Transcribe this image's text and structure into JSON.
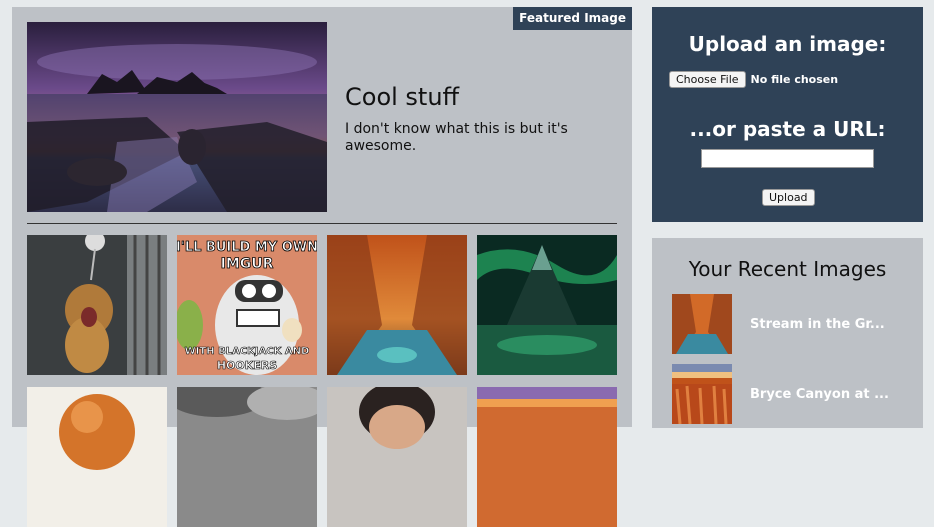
{
  "featured": {
    "badge": "Featured Image",
    "title": "Cool stuff",
    "description": "I don't know what this is but it's awesome."
  },
  "thumbnails": [
    {
      "name": "lion-cub-image"
    },
    {
      "name": "bender-meme-image",
      "top_text": "I'LL BUILD MY OWN IMGUR",
      "bottom_text": "WITH BLACKJACK AND HOOKERS"
    },
    {
      "name": "canyon-stream-image"
    },
    {
      "name": "aurora-mountain-image"
    },
    {
      "name": "furry-animal-image"
    },
    {
      "name": "storm-clouds-image"
    },
    {
      "name": "portrait-image"
    },
    {
      "name": "sunset-landscape-image"
    }
  ],
  "upload": {
    "title": "Upload an image:",
    "choose_file_label": "Choose File",
    "file_status": "No file chosen",
    "paste_url_title": "...or paste a URL:",
    "url_value": "",
    "upload_button": "Upload"
  },
  "recent": {
    "title": "Your Recent Images",
    "items": [
      {
        "label": "Stream in the Gr..."
      },
      {
        "label": "Bryce Canyon at ..."
      }
    ]
  },
  "colors": {
    "panel_bg": "#bdc1c6",
    "dark_panel": "#2f4257",
    "page_bg": "#e6eaec"
  }
}
